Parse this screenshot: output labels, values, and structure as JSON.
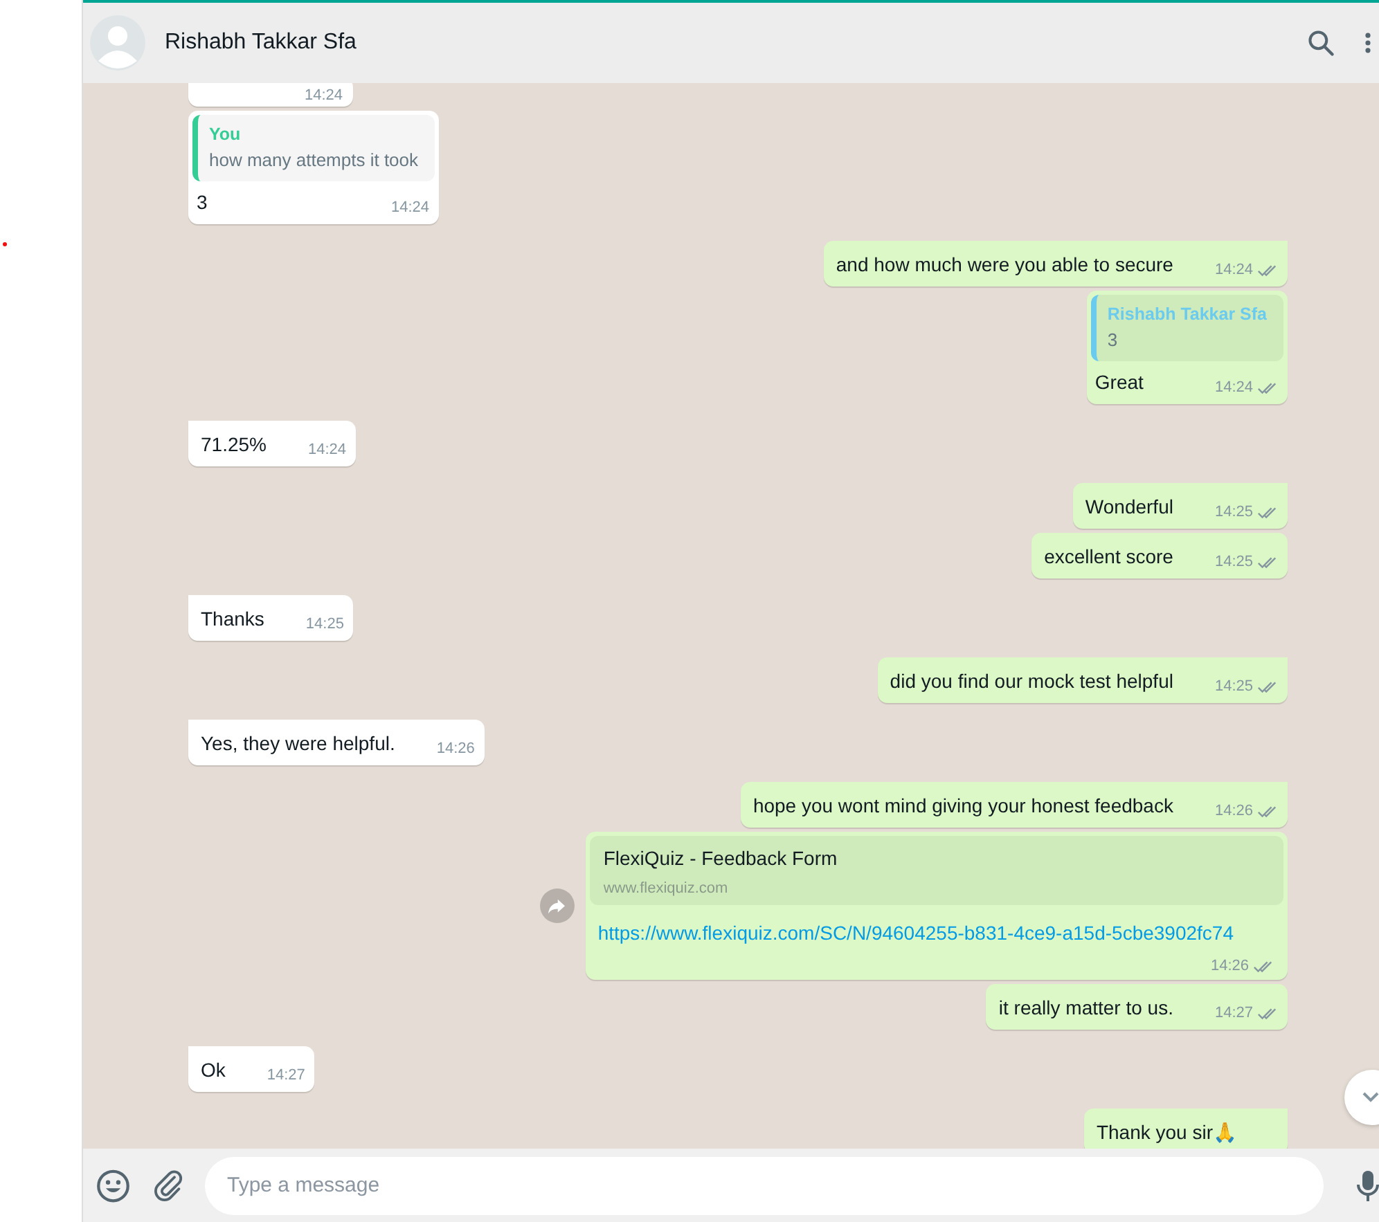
{
  "chat": {
    "contact_name": "Rishabh Takkar Sfa"
  },
  "messages": [
    {
      "outgoing": false,
      "kind": "text",
      "time": "14:24"
    },
    {
      "outgoing": false,
      "kind": "reply",
      "quote": {
        "author": "You",
        "text": "how many attempts it took",
        "color": "#35cd96"
      },
      "text": "3",
      "time": "14:24"
    },
    {
      "outgoing": true,
      "kind": "text",
      "text": "and how much were you able to secure",
      "time": "14:24",
      "read": false
    },
    {
      "outgoing": true,
      "kind": "reply",
      "quote": {
        "author": "Rishabh Takkar Sfa",
        "text": "3",
        "color": "#6bcbef"
      },
      "text": "Great",
      "time": "14:24",
      "read": false
    },
    {
      "outgoing": false,
      "kind": "text",
      "text": "71.25%",
      "time": "14:24"
    },
    {
      "outgoing": true,
      "kind": "text",
      "text": "Wonderful",
      "time": "14:25",
      "read": false
    },
    {
      "outgoing": true,
      "kind": "text",
      "text": "excellent score",
      "time": "14:25",
      "read": false
    },
    {
      "outgoing": false,
      "kind": "text",
      "text": "Thanks",
      "time": "14:25"
    },
    {
      "outgoing": true,
      "kind": "text",
      "text": "did you find our mock test helpful",
      "time": "14:25",
      "read": false
    },
    {
      "outgoing": false,
      "kind": "text",
      "text": "Yes, they were helpful.",
      "time": "14:26"
    },
    {
      "outgoing": true,
      "kind": "text",
      "text": "hope you wont mind giving your honest feedback",
      "time": "14:26",
      "read": false
    },
    {
      "outgoing": true,
      "kind": "link",
      "preview": {
        "title": "FlexiQuiz - Feedback Form",
        "domain": "www.flexiquiz.com"
      },
      "text": "https://www.flexiquiz.com/SC/N/94604255-b831-4ce9-a15d-5cbe3902fc74",
      "time": "14:26",
      "read": false
    },
    {
      "outgoing": true,
      "kind": "text",
      "text": "it really matter to us.",
      "time": "14:27",
      "read": false
    },
    {
      "outgoing": false,
      "kind": "text",
      "text": "Ok",
      "time": "14:27"
    },
    {
      "outgoing": true,
      "kind": "text",
      "text": "Thank you sir🙏"
    }
  ],
  "composer": {
    "placeholder": "Type a message"
  }
}
